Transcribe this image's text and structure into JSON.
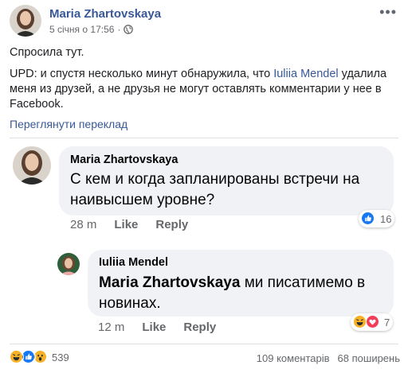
{
  "post": {
    "author": "Maria Zhartovskaya",
    "timestamp": "5 січня о 17:56",
    "separator": "·",
    "more_label": "•••",
    "text_line1": "Спросила тут.",
    "text_upd_before": "UPD: и спустя несколько минут обнаружила, что ",
    "text_upd_mention": "Iuliia Mendel",
    "text_upd_after": " удалила меня из друзей, а не друзья не могут оставлять комментарии у нее в Facebook.",
    "translate_link": "Переглянути переклад"
  },
  "comments": [
    {
      "author": "Maria Zhartovskaya",
      "text": "С кем и когда запланированы встречи на наивысшем уровне?",
      "time": "28 m",
      "like_label": "Like",
      "reply_label": "Reply",
      "reaction_count": "16",
      "reaction_icons": [
        "like-icon"
      ]
    }
  ],
  "reply": {
    "author": "Iuliia Mendel",
    "mention": "Maria Zhartovskaya",
    "text": " ми писатимемо в новинах.",
    "time": "12 m",
    "like_label": "Like",
    "reply_label": "Reply",
    "reaction_count": "7",
    "reaction_icons": [
      "haha-icon",
      "love-icon"
    ]
  },
  "footer": {
    "reaction_icons": [
      "haha-icon",
      "like-icon",
      "wow-icon"
    ],
    "reaction_count": "539",
    "comments_count": "109 коментарів",
    "shares_count": "68 поширень"
  },
  "colors": {
    "link": "#385898",
    "like_blue": "#1877f2",
    "love_red": "#f33e58",
    "haha_yellow": "#f7b125",
    "bubble_bg": "#f0f2f5",
    "meta_gray": "#65676b"
  }
}
